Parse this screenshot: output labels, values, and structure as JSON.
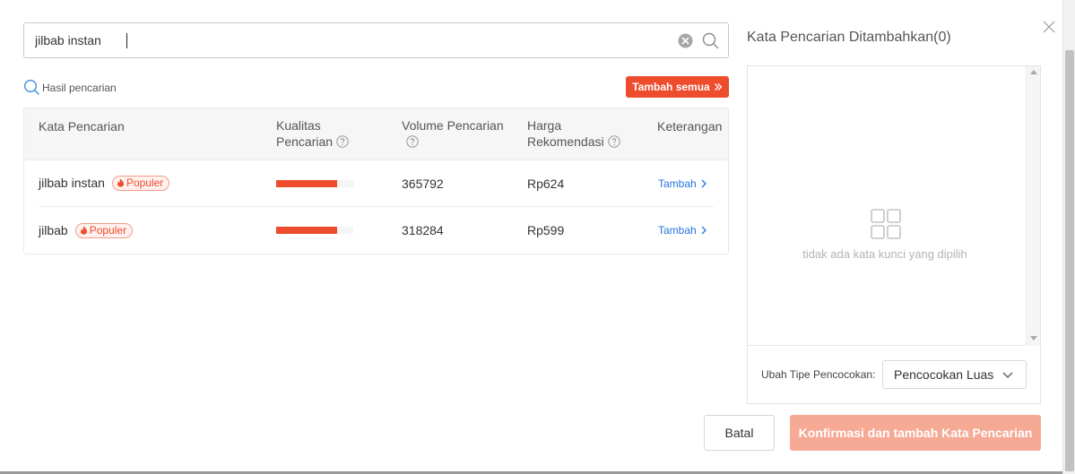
{
  "search": {
    "value": "jilbab instan"
  },
  "results": {
    "label": "Hasil pencarian",
    "add_all_label": "Tambah semua",
    "columns": {
      "keyword": "Kata Pencarian",
      "quality_line1": "Kualitas",
      "quality_line2": "Pencarian",
      "volume": "Volume Pencarian",
      "price_line1": "Harga",
      "price_line2": "Rekomendasi",
      "action": "Keterangan"
    },
    "rows": [
      {
        "keyword": "jilbab instan",
        "badge": "Populer",
        "quality": 0.79,
        "volume": "365792",
        "price": "Rp624",
        "action": "Tambah"
      },
      {
        "keyword": "jilbab",
        "badge": "Populer",
        "quality": 0.79,
        "volume": "318284",
        "price": "Rp599",
        "action": "Tambah"
      }
    ]
  },
  "added": {
    "title": "Kata Pencarian Ditambahkan(0)",
    "empty_text": "tidak ada kata kunci yang dipilih",
    "match_label": "Ubah Tipe Pencocokan:",
    "match_value": "Pencocokan Luas"
  },
  "footer": {
    "cancel_label": "Batal",
    "confirm_label": "Konfirmasi dan tambah Kata Pencarian"
  },
  "colors": {
    "accent": "#ee4d2d",
    "link": "#2673dd",
    "confirm_disabled": "#f6a995"
  }
}
